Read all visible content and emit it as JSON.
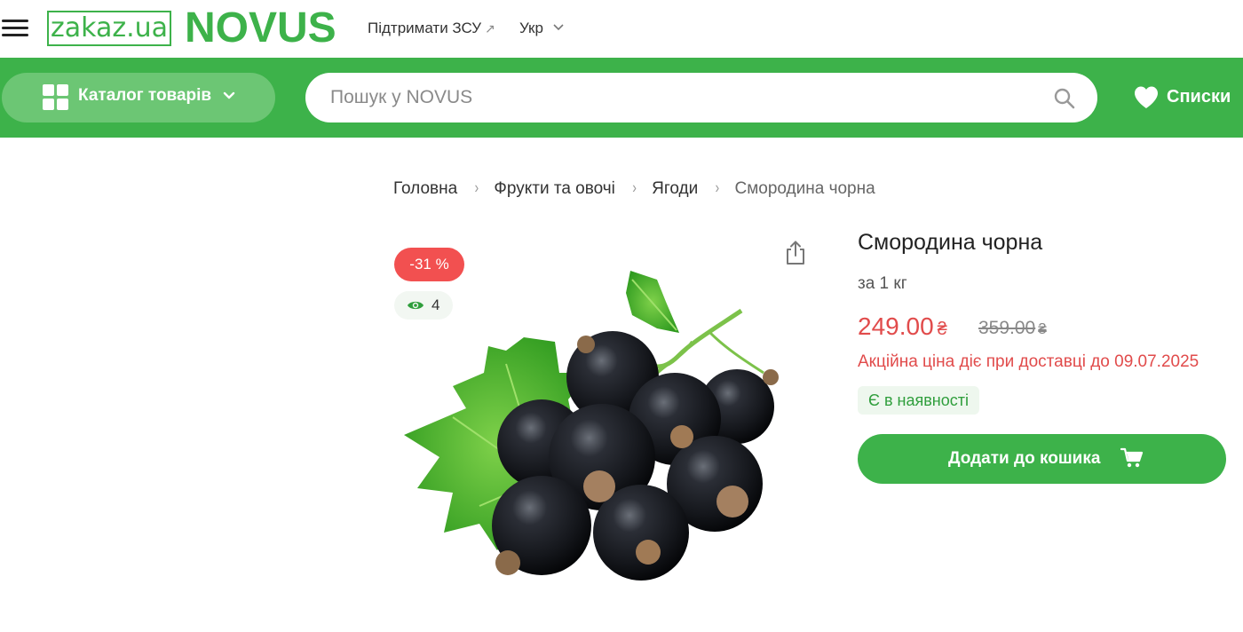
{
  "header": {
    "logo_zakaz": "zakaz.ua",
    "logo_novus": "NOVUS",
    "support_link": "Підтримати ЗСУ",
    "support_arrow": "↗",
    "language": "Укр"
  },
  "nav": {
    "catalog_label": "Каталог товарів",
    "search_placeholder": "Пошук у NOVUS",
    "lists_label": "Списки"
  },
  "breadcrumb": {
    "items": [
      "Головна",
      "Фрукти та овочі",
      "Ягоди"
    ],
    "current": "Смородина чорна",
    "separator": "›"
  },
  "product": {
    "discount_badge": "-31 %",
    "views_count": "4",
    "title": "Смородина чорна",
    "unit": "за 1 кг",
    "price": "249.00",
    "old_price": "359.00",
    "currency": "₴",
    "promo_text": "Акційна ціна діє при доставці до 09.07.2025",
    "stock_status": "Є в наявності",
    "add_to_cart_label": "Додати до кошика"
  },
  "colors": {
    "brand_green": "#3db24a",
    "light_green": "#6cc674",
    "sale_red": "#e14b4b",
    "badge_red": "#f25050",
    "stock_green": "#2f9e3c"
  },
  "icons": [
    "menu-icon",
    "external-link-icon",
    "chevron-down-icon",
    "grid-icon",
    "search-icon",
    "heart-icon",
    "share-icon",
    "eye-icon",
    "cart-icon"
  ]
}
